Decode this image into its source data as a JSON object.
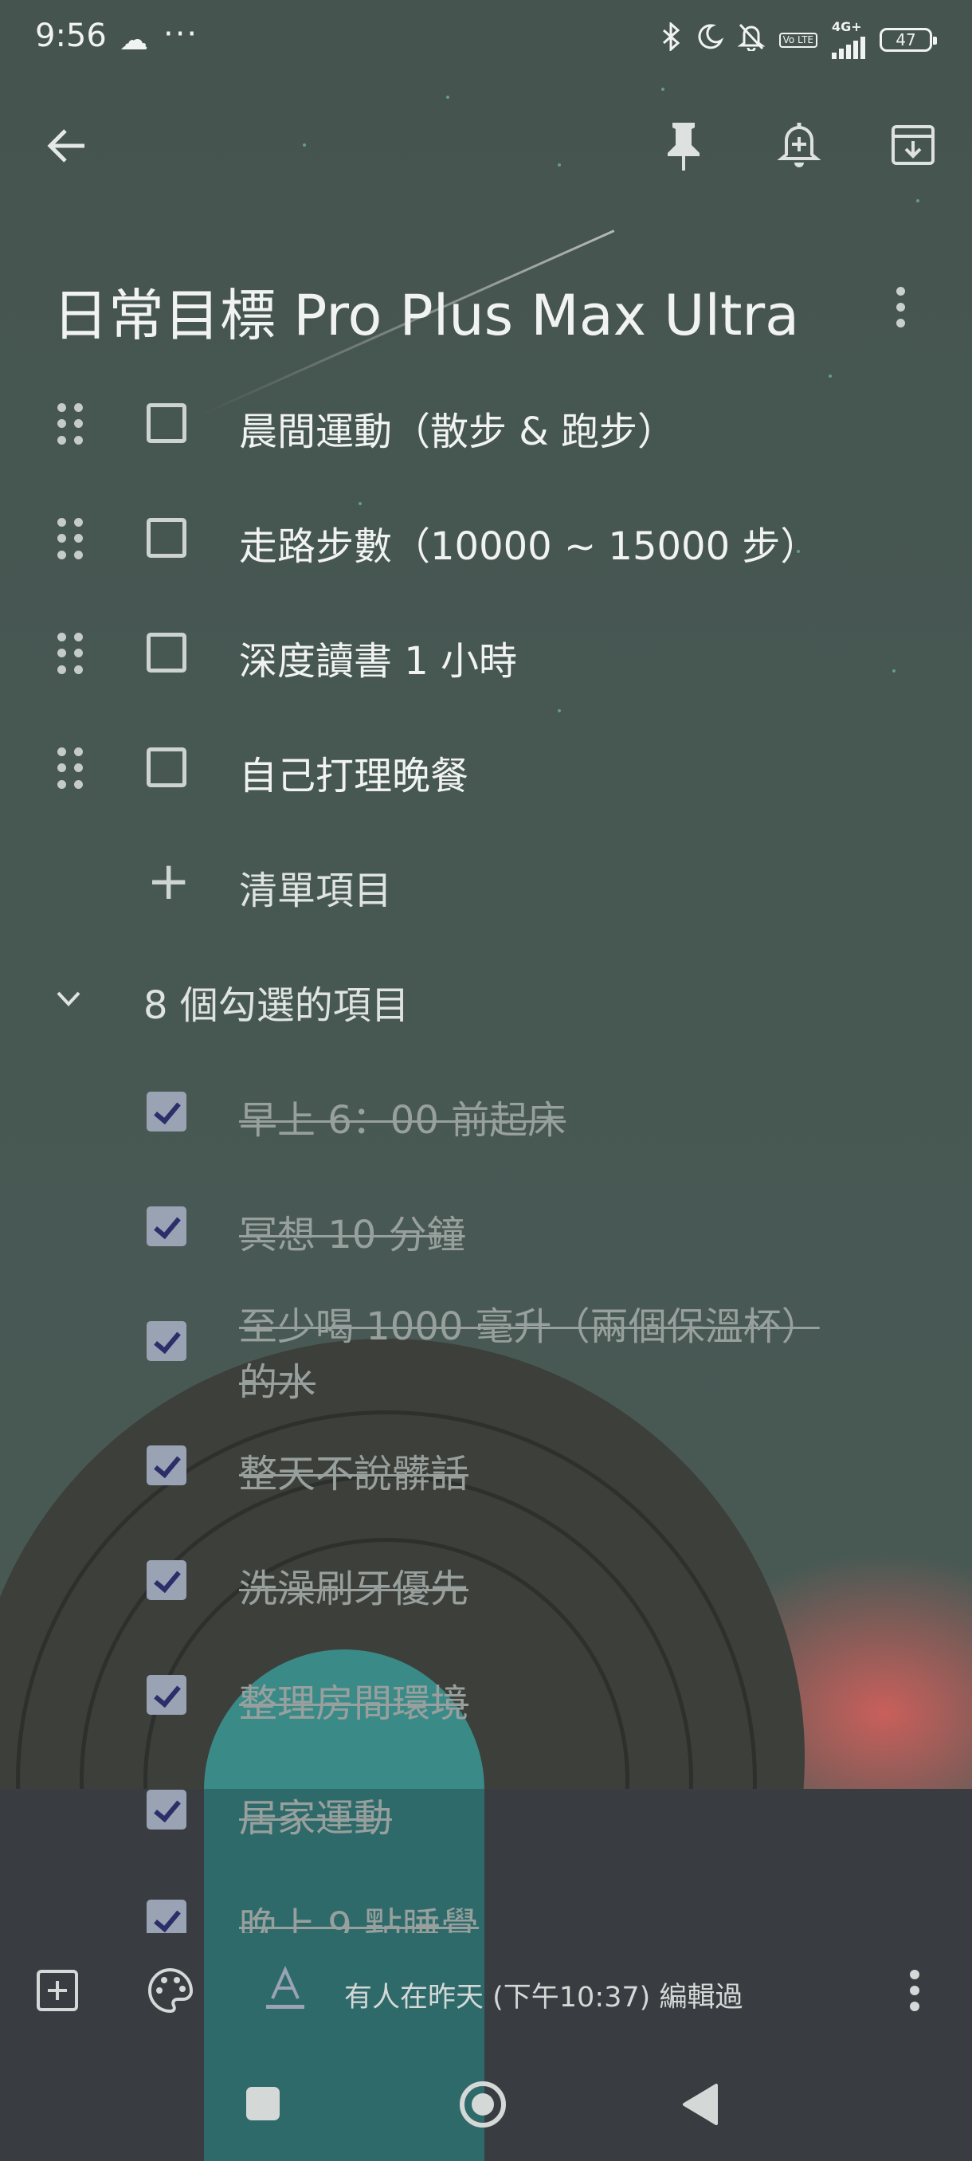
{
  "status_bar": {
    "time": "9:56",
    "more": "···",
    "volte": "Vo LTE",
    "network": "4G+",
    "battery": "47",
    "icons": [
      "cloud-icon",
      "bluetooth-icon",
      "moon-icon",
      "bell-off-icon",
      "volte-icon",
      "signal-icon",
      "battery-icon"
    ]
  },
  "toolbar": {
    "icons": [
      "back-arrow-icon",
      "pin-icon",
      "add-reminder-icon",
      "archive-icon"
    ]
  },
  "note": {
    "title": "日常目標 Pro Plus Max Ultra",
    "unchecked": [
      "晨間運動（散步 & 跑步）",
      "走路步數（10000 ~ 15000 步）",
      "深度讀書 1 小時",
      "自己打理晚餐"
    ],
    "add_item_label": "清單項目",
    "checked_header": "8 個勾選的項目",
    "checked": [
      "早上 6：00 前起床",
      "冥想 10 分鐘",
      "至少喝 1000 毫升（兩個保溫杯）的水",
      "整天不說髒話",
      "洗澡刷牙優先",
      "整理房間環境",
      "居家運動",
      "晚上 9 點睡覺"
    ]
  },
  "bottom_bar": {
    "edited_text": "有人在昨天 (下午10:37) 編輯過",
    "icons": [
      "add-box-icon",
      "palette-icon",
      "text-format-icon",
      "more-vert-icon"
    ]
  },
  "nav_bar": {
    "icons": [
      "recents-square-icon",
      "home-circle-icon",
      "back-triangle-icon"
    ]
  },
  "colors": {
    "background": "#46544f",
    "text": "#f1f3f2",
    "checked_text": "#98a09d",
    "checkbox_fill": "#9aa3b4",
    "accent_teal": "#3a8a88",
    "dusk_red": "#d7605c",
    "bottom_bar": "#393c41"
  }
}
